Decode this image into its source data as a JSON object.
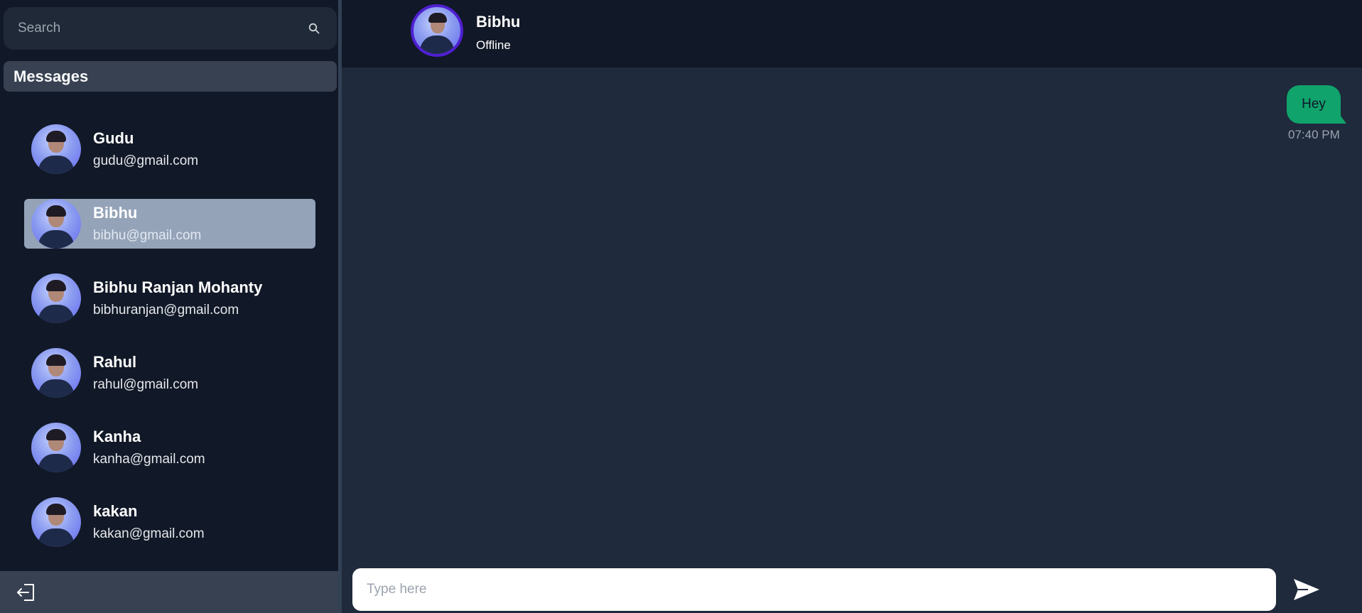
{
  "search": {
    "placeholder": "Search"
  },
  "sidebar": {
    "section_title": "Messages",
    "contacts": [
      {
        "name": "Gudu",
        "email": "gudu@gmail.com",
        "active": false
      },
      {
        "name": "Bibhu",
        "email": "bibhu@gmail.com",
        "active": true
      },
      {
        "name": "Bibhu Ranjan Mohanty",
        "email": "bibhuranjan@gmail.com",
        "active": false
      },
      {
        "name": "Rahul",
        "email": "rahul@gmail.com",
        "active": false
      },
      {
        "name": "Kanha",
        "email": "kanha@gmail.com",
        "active": false
      },
      {
        "name": "kakan",
        "email": "kakan@gmail.com",
        "active": false
      }
    ]
  },
  "chat": {
    "header": {
      "name": "Bibhu",
      "status": "Offline"
    },
    "messages": [
      {
        "text": "Hey",
        "time": "07:40 PM",
        "from_me": true
      }
    ],
    "composer": {
      "placeholder": "Type here"
    }
  },
  "icons": {
    "search": "search-icon",
    "logout": "logout-icon",
    "send": "send-icon",
    "avatar": "avatar"
  },
  "colors": {
    "sidebar_bg": "#111827",
    "chat_bg": "#1f2a3c",
    "active_contact": "#94a3b8",
    "message_bubble": "#10a36b",
    "avatar_ring": "#4f1fd1"
  }
}
